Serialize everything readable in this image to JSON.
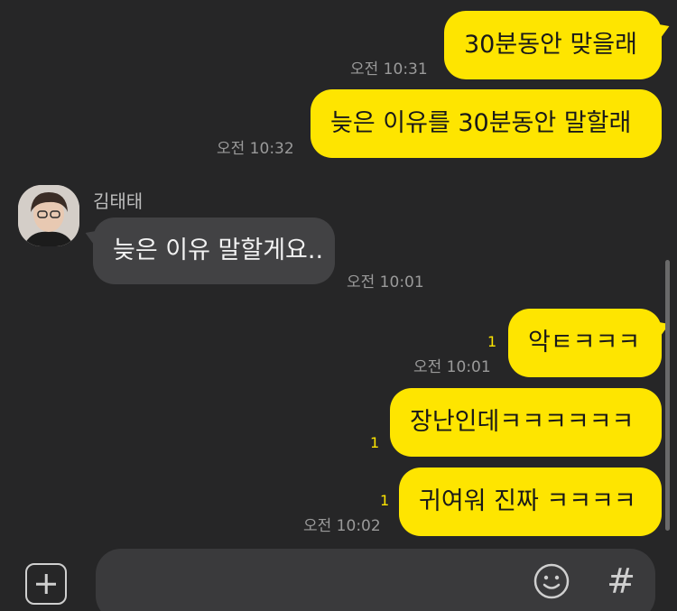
{
  "messages": [
    {
      "text": "30분동안 맞을래",
      "time": "오전 10:31"
    },
    {
      "text": "늦은 이유를 30분동안 말할래",
      "time": "오전 10:32"
    },
    {
      "sender": "김태태",
      "text": "늦은 이유 말할게요..",
      "time": "오전 10:01"
    },
    {
      "text": "악ㅌㅋㅋㅋ",
      "unread": "1",
      "time": "오전 10:01"
    },
    {
      "text": "장난인데ㅋㅋㅋㅋㅋㅋ",
      "unread": "1"
    },
    {
      "text": "귀여워 진짜 ㅋㅋㅋㅋ",
      "unread": "1",
      "time": "오전 10:02"
    }
  ],
  "composer": {
    "plus_icon": "plus-square-icon",
    "emoji_icon": "smiley-icon",
    "hash_label": "#"
  },
  "colors": {
    "background": "#262627",
    "my_bubble": "#fee500",
    "their_bubble": "#424244",
    "unread": "#fee500"
  }
}
